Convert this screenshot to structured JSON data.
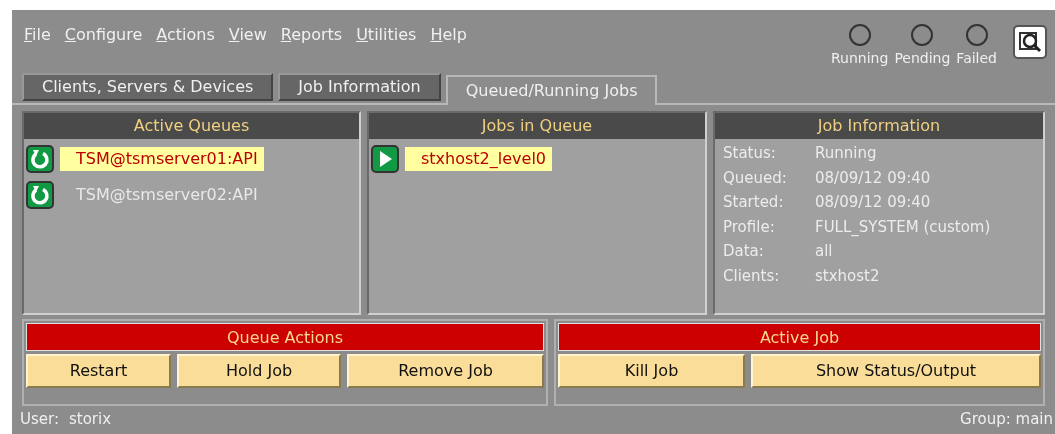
{
  "menu": [
    "File",
    "Configure",
    "Actions",
    "View",
    "Reports",
    "Utilities",
    "Help"
  ],
  "status_lights": [
    {
      "label": "Running",
      "on": false
    },
    {
      "label": "Pending",
      "on": false
    },
    {
      "label": "Failed",
      "on": false
    }
  ],
  "tabs": [
    {
      "label": "Clients, Servers & Devices",
      "selected": false
    },
    {
      "label": "Job Information",
      "selected": false
    },
    {
      "label": "Queued/Running Jobs",
      "selected": true
    }
  ],
  "active_queues": {
    "title": "Active Queues",
    "items": [
      {
        "label": "TSM@tsmserver01:API",
        "selected": true
      },
      {
        "label": "TSM@tsmserver02:API",
        "selected": false
      }
    ]
  },
  "jobs_in_queue": {
    "title": "Jobs in Queue",
    "items": [
      {
        "label": "stxhost2_level0",
        "selected": true
      }
    ]
  },
  "job_information": {
    "title": "Job Information",
    "fields": [
      {
        "label": "Status:",
        "value": "Running"
      },
      {
        "label": "Queued:",
        "value": "08/09/12 09:40"
      },
      {
        "label": "Started:",
        "value": "08/09/12 09:40"
      },
      {
        "label": "Profile:",
        "value": "FULL_SYSTEM (custom)"
      },
      {
        "label": "Data:",
        "value": "all"
      },
      {
        "label": "Clients:",
        "value": "stxhost2"
      }
    ]
  },
  "queue_actions": {
    "title": "Queue Actions",
    "buttons": [
      "Restart",
      "Hold Job",
      "Remove Job"
    ]
  },
  "active_job": {
    "title": "Active Job",
    "buttons": [
      "Kill Job",
      "Show Status/Output"
    ]
  },
  "status_bar": {
    "user_label": "User:",
    "user": "storix",
    "group": "Group: main"
  }
}
